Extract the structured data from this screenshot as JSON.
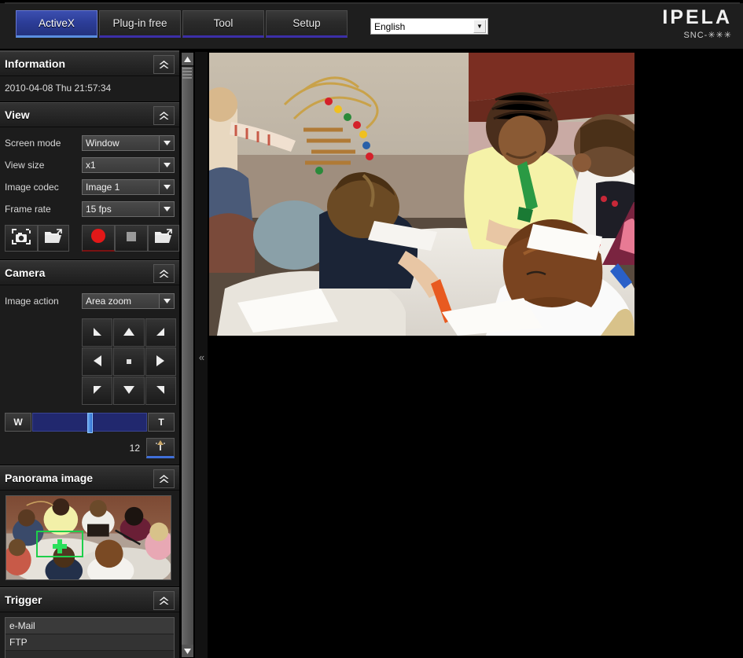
{
  "header": {
    "tabs": [
      {
        "label": "ActiveX",
        "active": true
      },
      {
        "label": "Plug-in free",
        "active": false
      },
      {
        "label": "Tool",
        "active": false
      },
      {
        "label": "Setup",
        "active": false
      }
    ],
    "language": {
      "value": "English",
      "placeholder": "English",
      "arrow_icon": "chevron-down-icon"
    },
    "logo": {
      "brand": "IPELA",
      "model": "SNC-✳✳✳"
    }
  },
  "sidebar": {
    "panels": [
      {
        "key": "information",
        "title": "Information",
        "collapse_icon": "double-chevron-up-icon",
        "datetime": "2010-04-08 Thu 21:57:34"
      },
      {
        "key": "view",
        "title": "View",
        "collapse_icon": "double-chevron-up-icon",
        "rows": [
          {
            "label": "Screen mode",
            "value": "Window"
          },
          {
            "label": "View size",
            "value": "x1"
          },
          {
            "label": "Image codec",
            "value": "Image 1"
          },
          {
            "label": "Frame rate",
            "value": "15 fps"
          }
        ],
        "buttons": [
          {
            "name": "snapshot-button",
            "icon": "camera-snapshot-icon"
          },
          {
            "name": "snapshot-folder-button",
            "icon": "open-folder-icon"
          },
          {
            "name": "record-button",
            "icon": "record-circle-icon"
          },
          {
            "name": "stop-button",
            "icon": "stop-square-icon"
          },
          {
            "name": "record-folder-button",
            "icon": "open-folder-icon"
          }
        ]
      },
      {
        "key": "camera",
        "title": "Camera",
        "collapse_icon": "double-chevron-up-icon",
        "image_action": {
          "label": "Image action",
          "value": "Area zoom"
        },
        "pad": [
          {
            "name": "pan-up-left",
            "icon": "arrow-up-left-icon",
            "glyph": "◢"
          },
          {
            "name": "pan-up",
            "icon": "arrow-up-icon",
            "glyph": "▲"
          },
          {
            "name": "pan-up-right",
            "icon": "arrow-up-right-icon",
            "glyph": "◣"
          },
          {
            "name": "pan-left",
            "icon": "arrow-left-icon",
            "glyph": "◀"
          },
          {
            "name": "pan-home",
            "icon": "home-dot-icon",
            "glyph": ""
          },
          {
            "name": "pan-right",
            "icon": "arrow-right-icon",
            "glyph": "▶"
          },
          {
            "name": "pan-down-left",
            "icon": "arrow-down-left-icon",
            "glyph": "◥"
          },
          {
            "name": "pan-down",
            "icon": "arrow-down-icon",
            "glyph": "▼"
          },
          {
            "name": "pan-down-right",
            "icon": "arrow-down-right-icon",
            "glyph": "◤"
          }
        ],
        "zoom": {
          "wide_label": "W",
          "tele_label": "T",
          "value": "12",
          "slider_percent": 48,
          "focus_icon": "focus-crosshair-icon"
        }
      },
      {
        "key": "panorama",
        "title": "Panorama image",
        "collapse_icon": "double-chevron-up-icon",
        "selection_color": "#1ecf4a",
        "crosshair_icon": "green-crosshair-icon"
      },
      {
        "key": "trigger",
        "title": "Trigger",
        "collapse_icon": "double-chevron-up-icon",
        "items": [
          {
            "label": "e-Mail"
          },
          {
            "label": "FTP"
          }
        ]
      }
    ],
    "scrollbar": {
      "up_icon": "scroll-up-arrow-icon",
      "down_icon": "scroll-down-arrow-icon",
      "grip_icon": "grip-lines-icon"
    },
    "divider": {
      "collapse_icon": "double-chevron-left-icon",
      "glyph": "«"
    }
  },
  "main": {
    "video": {
      "name": "live-video-stream",
      "scene": "classroom with children drawing at a table"
    }
  },
  "colors": {
    "accent_blue": "#2b3c96",
    "tab_underline": "#3c2fa8",
    "active_underline": "#5a8fe0",
    "panel_bg": "#1c1c1c",
    "record_red": "#e02020",
    "slider_track": "#21286e",
    "pano_select_green": "#1ecf4a"
  }
}
